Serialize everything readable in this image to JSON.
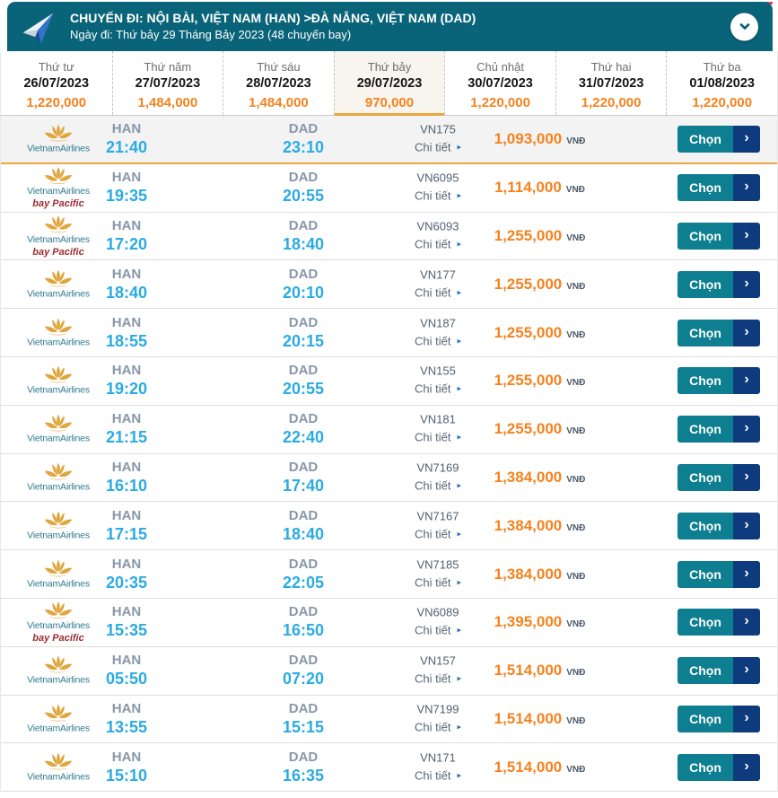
{
  "header": {
    "title": "CHUYẾN ĐI: NỘI BÀI, VIỆT NAM (HAN) >ĐÀ NẴNG, VIỆT NAM (DAD)",
    "subtitle": "Ngày đi: Thứ bảy 29 Tháng Bảy 2023 (48 chuyến bay)"
  },
  "colors": {
    "header_teal": "#0a6479",
    "button_teal": "#0e7e91",
    "button_navy": "#0d3b7d",
    "price_orange": "#f5821f",
    "highlight_orange": "#f0a63e",
    "time_blue": "#2aabe2",
    "accent_red": "#e8415c"
  },
  "labels": {
    "details": "Chi tiết",
    "select": "Chọn",
    "currency": "VNĐ"
  },
  "icons": {
    "details_arrow": "▸",
    "select_arrow": "›"
  },
  "airline": {
    "name": "VietnamAirlines",
    "sub": "bay Pacific"
  },
  "date_tabs": [
    {
      "day": "Thứ tư",
      "date": "26/07/2023",
      "price": "1,220,000",
      "selected": false
    },
    {
      "day": "Thứ năm",
      "date": "27/07/2023",
      "price": "1,484,000",
      "selected": false
    },
    {
      "day": "Thứ sáu",
      "date": "28/07/2023",
      "price": "1,484,000",
      "selected": false
    },
    {
      "day": "Thứ bảy",
      "date": "29/07/2023",
      "price": "970,000",
      "selected": true
    },
    {
      "day": "Chủ nhật",
      "date": "30/07/2023",
      "price": "1,220,000",
      "selected": false
    },
    {
      "day": "Thứ hai",
      "date": "31/07/2023",
      "price": "1,220,000",
      "selected": false
    },
    {
      "day": "Thứ ba",
      "date": "01/08/2023",
      "price": "1,220,000",
      "selected": false
    }
  ],
  "flights": [
    {
      "origin": "HAN",
      "dep": "21:40",
      "dest": "DAD",
      "arr": "23:10",
      "flight_no": "VN175",
      "price": "1,093,000",
      "bay_pacific": false,
      "highlighted": true
    },
    {
      "origin": "HAN",
      "dep": "19:35",
      "dest": "DAD",
      "arr": "20:55",
      "flight_no": "VN6095",
      "price": "1,114,000",
      "bay_pacific": true,
      "highlighted": false
    },
    {
      "origin": "HAN",
      "dep": "17:20",
      "dest": "DAD",
      "arr": "18:40",
      "flight_no": "VN6093",
      "price": "1,255,000",
      "bay_pacific": true,
      "highlighted": false
    },
    {
      "origin": "HAN",
      "dep": "18:40",
      "dest": "DAD",
      "arr": "20:10",
      "flight_no": "VN177",
      "price": "1,255,000",
      "bay_pacific": false,
      "highlighted": false
    },
    {
      "origin": "HAN",
      "dep": "18:55",
      "dest": "DAD",
      "arr": "20:15",
      "flight_no": "VN187",
      "price": "1,255,000",
      "bay_pacific": false,
      "highlighted": false
    },
    {
      "origin": "HAN",
      "dep": "19:20",
      "dest": "DAD",
      "arr": "20:55",
      "flight_no": "VN155",
      "price": "1,255,000",
      "bay_pacific": false,
      "highlighted": false
    },
    {
      "origin": "HAN",
      "dep": "21:15",
      "dest": "DAD",
      "arr": "22:40",
      "flight_no": "VN181",
      "price": "1,255,000",
      "bay_pacific": false,
      "highlighted": false
    },
    {
      "origin": "HAN",
      "dep": "16:10",
      "dest": "DAD",
      "arr": "17:40",
      "flight_no": "VN7169",
      "price": "1,384,000",
      "bay_pacific": false,
      "highlighted": false
    },
    {
      "origin": "HAN",
      "dep": "17:15",
      "dest": "DAD",
      "arr": "18:40",
      "flight_no": "VN7167",
      "price": "1,384,000",
      "bay_pacific": false,
      "highlighted": false
    },
    {
      "origin": "HAN",
      "dep": "20:35",
      "dest": "DAD",
      "arr": "22:05",
      "flight_no": "VN7185",
      "price": "1,384,000",
      "bay_pacific": false,
      "highlighted": false
    },
    {
      "origin": "HAN",
      "dep": "15:35",
      "dest": "DAD",
      "arr": "16:50",
      "flight_no": "VN6089",
      "price": "1,395,000",
      "bay_pacific": true,
      "highlighted": false
    },
    {
      "origin": "HAN",
      "dep": "05:50",
      "dest": "DAD",
      "arr": "07:20",
      "flight_no": "VN157",
      "price": "1,514,000",
      "bay_pacific": false,
      "highlighted": false
    },
    {
      "origin": "HAN",
      "dep": "13:55",
      "dest": "DAD",
      "arr": "15:15",
      "flight_no": "VN7199",
      "price": "1,514,000",
      "bay_pacific": false,
      "highlighted": false
    },
    {
      "origin": "HAN",
      "dep": "15:10",
      "dest": "DAD",
      "arr": "16:35",
      "flight_no": "VN171",
      "price": "1,514,000",
      "bay_pacific": false,
      "highlighted": false
    }
  ]
}
